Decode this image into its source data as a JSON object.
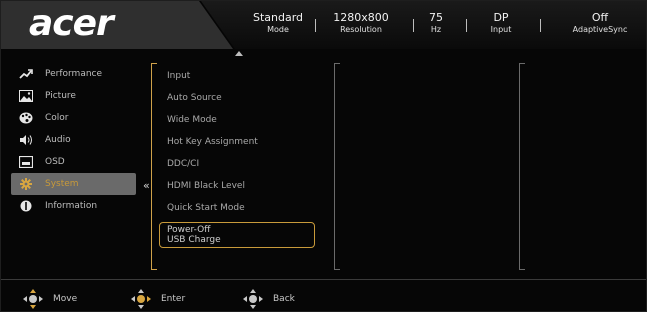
{
  "brand": {
    "logo_text": "acer"
  },
  "status_bar": [
    {
      "value": "Standard",
      "label": "Mode"
    },
    {
      "value": "1280x800",
      "label": "Resolution"
    },
    {
      "value": "75",
      "label": "Hz"
    },
    {
      "value": "DP",
      "label": "Input"
    },
    {
      "value": "Off",
      "label": "AdaptiveSync"
    }
  ],
  "sidebar": {
    "items": [
      {
        "label": "Performance",
        "icon": "performance-icon"
      },
      {
        "label": "Picture",
        "icon": "picture-icon"
      },
      {
        "label": "Color",
        "icon": "color-icon"
      },
      {
        "label": "Audio",
        "icon": "audio-icon"
      },
      {
        "label": "OSD",
        "icon": "osd-icon"
      },
      {
        "label": "System",
        "icon": "system-icon",
        "active": true
      },
      {
        "label": "Information",
        "icon": "information-icon"
      }
    ]
  },
  "menu": {
    "items": [
      "Input",
      "Auto Source",
      "Wide Mode",
      "Hot Key Assignment",
      "DDC/CI",
      "HDMI Black Level",
      "Quick Start Mode"
    ],
    "selected": {
      "line1": "Power-Off",
      "line2": "USB Charge"
    }
  },
  "footer": {
    "move": "Move",
    "enter": "Enter",
    "back": "Back"
  },
  "colors": {
    "accent": "#d8a640",
    "active_bg": "#6a6a6a",
    "header_bg": "#2f2f2f"
  }
}
